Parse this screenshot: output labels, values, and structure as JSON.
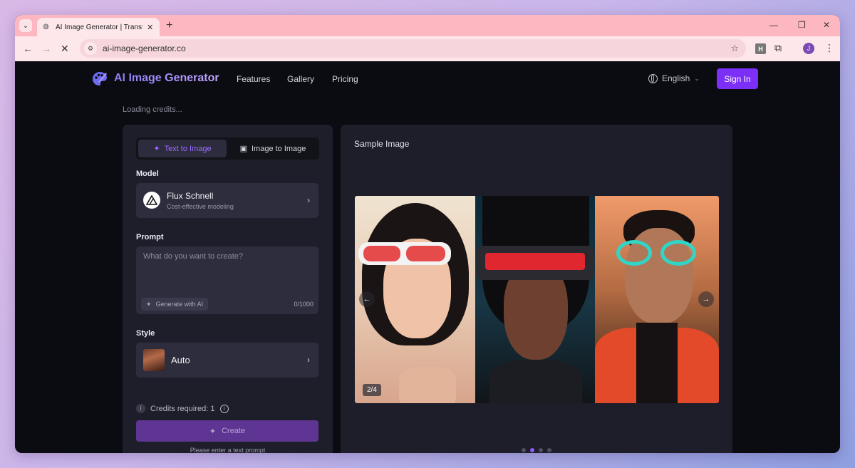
{
  "browser": {
    "tab_title": "AI Image Generator | Transform",
    "url": "ai-image-generator.co",
    "profile_initial": "J",
    "extension_h": "H"
  },
  "header": {
    "logo_text": "AI Image Generator",
    "nav": [
      "Features",
      "Gallery",
      "Pricing"
    ],
    "language": "English",
    "sign_in": "Sign In"
  },
  "status": {
    "loading": "Loading credits..."
  },
  "generator": {
    "tabs": {
      "text_to_image": "Text to Image",
      "image_to_image": "Image to Image"
    },
    "model_label": "Model",
    "model": {
      "name": "Flux Schnell",
      "description": "Cost-effective modeling"
    },
    "prompt_label": "Prompt",
    "prompt_placeholder": "What do you want to create?",
    "generate_with_ai": "Generate with AI",
    "char_count": "0/1000",
    "style_label": "Style",
    "style_value": "Auto",
    "credits": "Credits required: 1",
    "create": "Create",
    "hint": "Please enter a text prompt"
  },
  "preview": {
    "title": "Sample Image",
    "counter": "2/4",
    "slide_count": 4,
    "active_slide": 2
  },
  "colors": {
    "accent": "#7b2ff7",
    "panel": "#1e1e2b",
    "background": "#0b0b12"
  }
}
